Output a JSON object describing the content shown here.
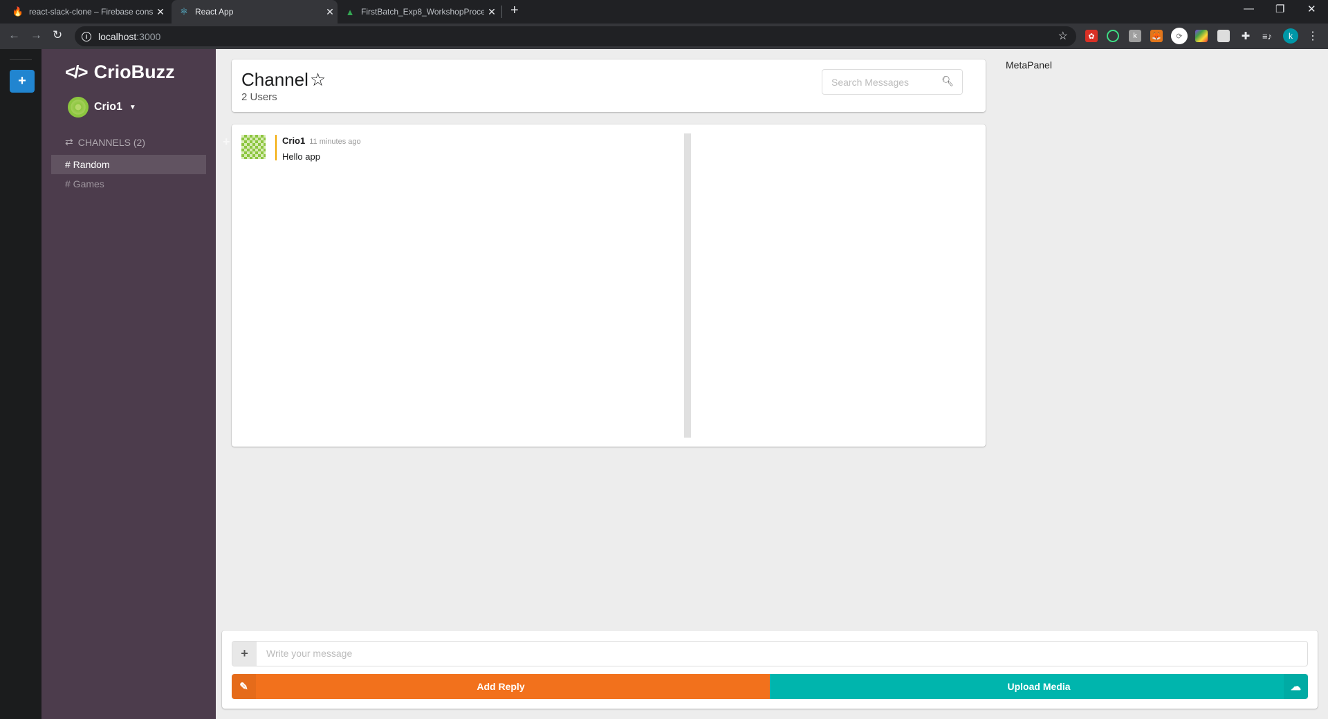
{
  "browser": {
    "tabs": [
      {
        "title": "react-slack-clone – Firebase cons",
        "icon": "firebase-icon",
        "active": false
      },
      {
        "title": "React App",
        "icon": "react-icon",
        "active": true
      },
      {
        "title": "FirstBatch_Exp8_WorkshopProces",
        "icon": "google-drive-icon",
        "active": false
      }
    ],
    "new_tab_label": "+",
    "url_host": "localhost",
    "url_port": ":3000",
    "profile_initial": "k",
    "extensions": [
      "ext-red-icon",
      "ext-green-ring-icon",
      "ext-k-icon",
      "metamask-fox-icon",
      "ext-sync-icon",
      "ext-colorful-icon",
      "ext-placeholder-icon",
      "puzzle-icon",
      "media-control-icon"
    ]
  },
  "strip": {
    "add_label": "+"
  },
  "sidebar": {
    "brand": "CrioBuzz",
    "logo": "</>",
    "user": "Crio1",
    "channels_label": "CHANNELS (2)",
    "channels": [
      {
        "label": "# Random",
        "active": true
      },
      {
        "label": "# Games",
        "active": false
      }
    ]
  },
  "header": {
    "title": "Channel",
    "star": "☆",
    "users": "2 Users",
    "search_placeholder": "Search Messages"
  },
  "messages": [
    {
      "author": "Crio1",
      "time": "11 minutes ago",
      "text": "Hello app"
    }
  ],
  "metapanel": {
    "label": "MetaPanel"
  },
  "form": {
    "placeholder": "Write your message",
    "reply_label": "Add Reply",
    "upload_label": "Upload Media"
  },
  "colors": {
    "sidebar": "#4c3c4c",
    "reply": "#f2711c",
    "upload": "#00b5ad",
    "accent_blue": "#2185d0",
    "message_border": "#f2a900"
  }
}
